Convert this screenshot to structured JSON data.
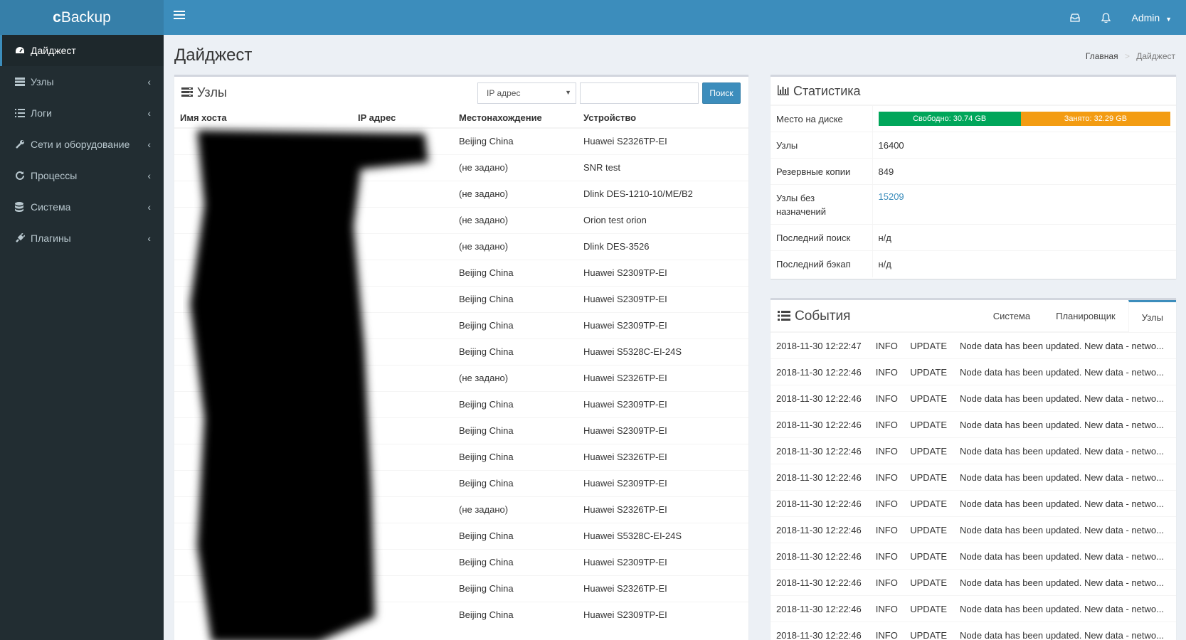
{
  "app": {
    "logo_bold": "c",
    "logo_rest": "Backup"
  },
  "topbar": {
    "user": "Admin"
  },
  "sidebar": {
    "items": [
      {
        "label": "Дайджест",
        "icon": "dashboard-icon",
        "active": true
      },
      {
        "label": "Узлы",
        "icon": "server-icon"
      },
      {
        "label": "Логи",
        "icon": "list-icon"
      },
      {
        "label": "Сети и оборудование",
        "icon": "wrench-icon"
      },
      {
        "label": "Процессы",
        "icon": "refresh-icon"
      },
      {
        "label": "Система",
        "icon": "database-icon"
      },
      {
        "label": "Плагины",
        "icon": "plug-icon"
      }
    ]
  },
  "page": {
    "title": "Дайджест",
    "breadcrumb": {
      "home": "Главная",
      "current": "Дайджест"
    }
  },
  "nodes": {
    "title": "Узлы",
    "filter_selected": "IP адрес",
    "search_button": "Поиск",
    "search_value": "",
    "columns": [
      "Имя хоста",
      "IP адрес",
      "Местонахождение",
      "Устройство"
    ],
    "rows": [
      [
        "Beijing China",
        "Huawei S2326TP-EI"
      ],
      [
        "(не задано)",
        "SNR test"
      ],
      [
        "(не задано)",
        "Dlink DES-1210-10/ME/B2"
      ],
      [
        "(не задано)",
        "Orion test orion"
      ],
      [
        "(не задано)",
        "Dlink DES-3526"
      ],
      [
        "Beijing China",
        "Huawei S2309TP-EI"
      ],
      [
        "Beijing China",
        "Huawei S2309TP-EI"
      ],
      [
        "Beijing China",
        "Huawei S2309TP-EI"
      ],
      [
        "Beijing China",
        "Huawei S5328C-EI-24S"
      ],
      [
        "(не задано)",
        "Huawei S2326TP-EI"
      ],
      [
        "Beijing China",
        "Huawei S2309TP-EI"
      ],
      [
        "Beijing China",
        "Huawei S2309TP-EI"
      ],
      [
        "Beijing China",
        "Huawei S2326TP-EI"
      ],
      [
        "Beijing China",
        "Huawei S2309TP-EI"
      ],
      [
        "(не задано)",
        "Huawei S2326TP-EI"
      ],
      [
        "Beijing China",
        "Huawei S5328C-EI-24S"
      ],
      [
        "Beijing China",
        "Huawei S2309TP-EI"
      ],
      [
        "Beijing China",
        "Huawei S2326TP-EI"
      ],
      [
        "Beijing China",
        "Huawei S2309TP-EI"
      ]
    ]
  },
  "stats": {
    "title": "Статистика",
    "disk_label": "Место на диске",
    "disk_free": "Свободно: 30.74 GB",
    "disk_used": "Занято: 32.29 GB",
    "disk_free_fraction": 0.488,
    "rows": [
      {
        "label": "Узлы",
        "value": "16400"
      },
      {
        "label": "Резервные копии",
        "value": "849"
      },
      {
        "label": "Узлы без назначений",
        "value": "15209",
        "link": true
      },
      {
        "label": "Последний поиск",
        "value": "н/д"
      },
      {
        "label": "Последний бэкап",
        "value": "н/д"
      }
    ]
  },
  "events": {
    "title": "События",
    "tabs": [
      "Система",
      "Планировщик",
      "Узлы"
    ],
    "active_tab": "Узлы",
    "rows": [
      [
        "2018-11-30 12:22:47",
        "INFO",
        "UPDATE",
        "Node data has been updated. New data - netwo..."
      ],
      [
        "2018-11-30 12:22:46",
        "INFO",
        "UPDATE",
        "Node data has been updated. New data - netwo..."
      ],
      [
        "2018-11-30 12:22:46",
        "INFO",
        "UPDATE",
        "Node data has been updated. New data - netwo..."
      ],
      [
        "2018-11-30 12:22:46",
        "INFO",
        "UPDATE",
        "Node data has been updated. New data - netwo..."
      ],
      [
        "2018-11-30 12:22:46",
        "INFO",
        "UPDATE",
        "Node data has been updated. New data - netwo..."
      ],
      [
        "2018-11-30 12:22:46",
        "INFO",
        "UPDATE",
        "Node data has been updated. New data - netwo..."
      ],
      [
        "2018-11-30 12:22:46",
        "INFO",
        "UPDATE",
        "Node data has been updated. New data - netwo..."
      ],
      [
        "2018-11-30 12:22:46",
        "INFO",
        "UPDATE",
        "Node data has been updated. New data - netwo..."
      ],
      [
        "2018-11-30 12:22:46",
        "INFO",
        "UPDATE",
        "Node data has been updated. New data - netwo..."
      ],
      [
        "2018-11-30 12:22:46",
        "INFO",
        "UPDATE",
        "Node data has been updated. New data - netwo..."
      ],
      [
        "2018-11-30 12:22:46",
        "INFO",
        "UPDATE",
        "Node data has been updated. New data - netwo..."
      ],
      [
        "2018-11-30 12:22:46",
        "INFO",
        "UPDATE",
        "Node data has been updated. New data - netwo..."
      ]
    ]
  },
  "colors": {
    "primary": "#3c8dbc",
    "sidebar": "#222d32",
    "free": "#00a65a",
    "used": "#f39c12"
  }
}
